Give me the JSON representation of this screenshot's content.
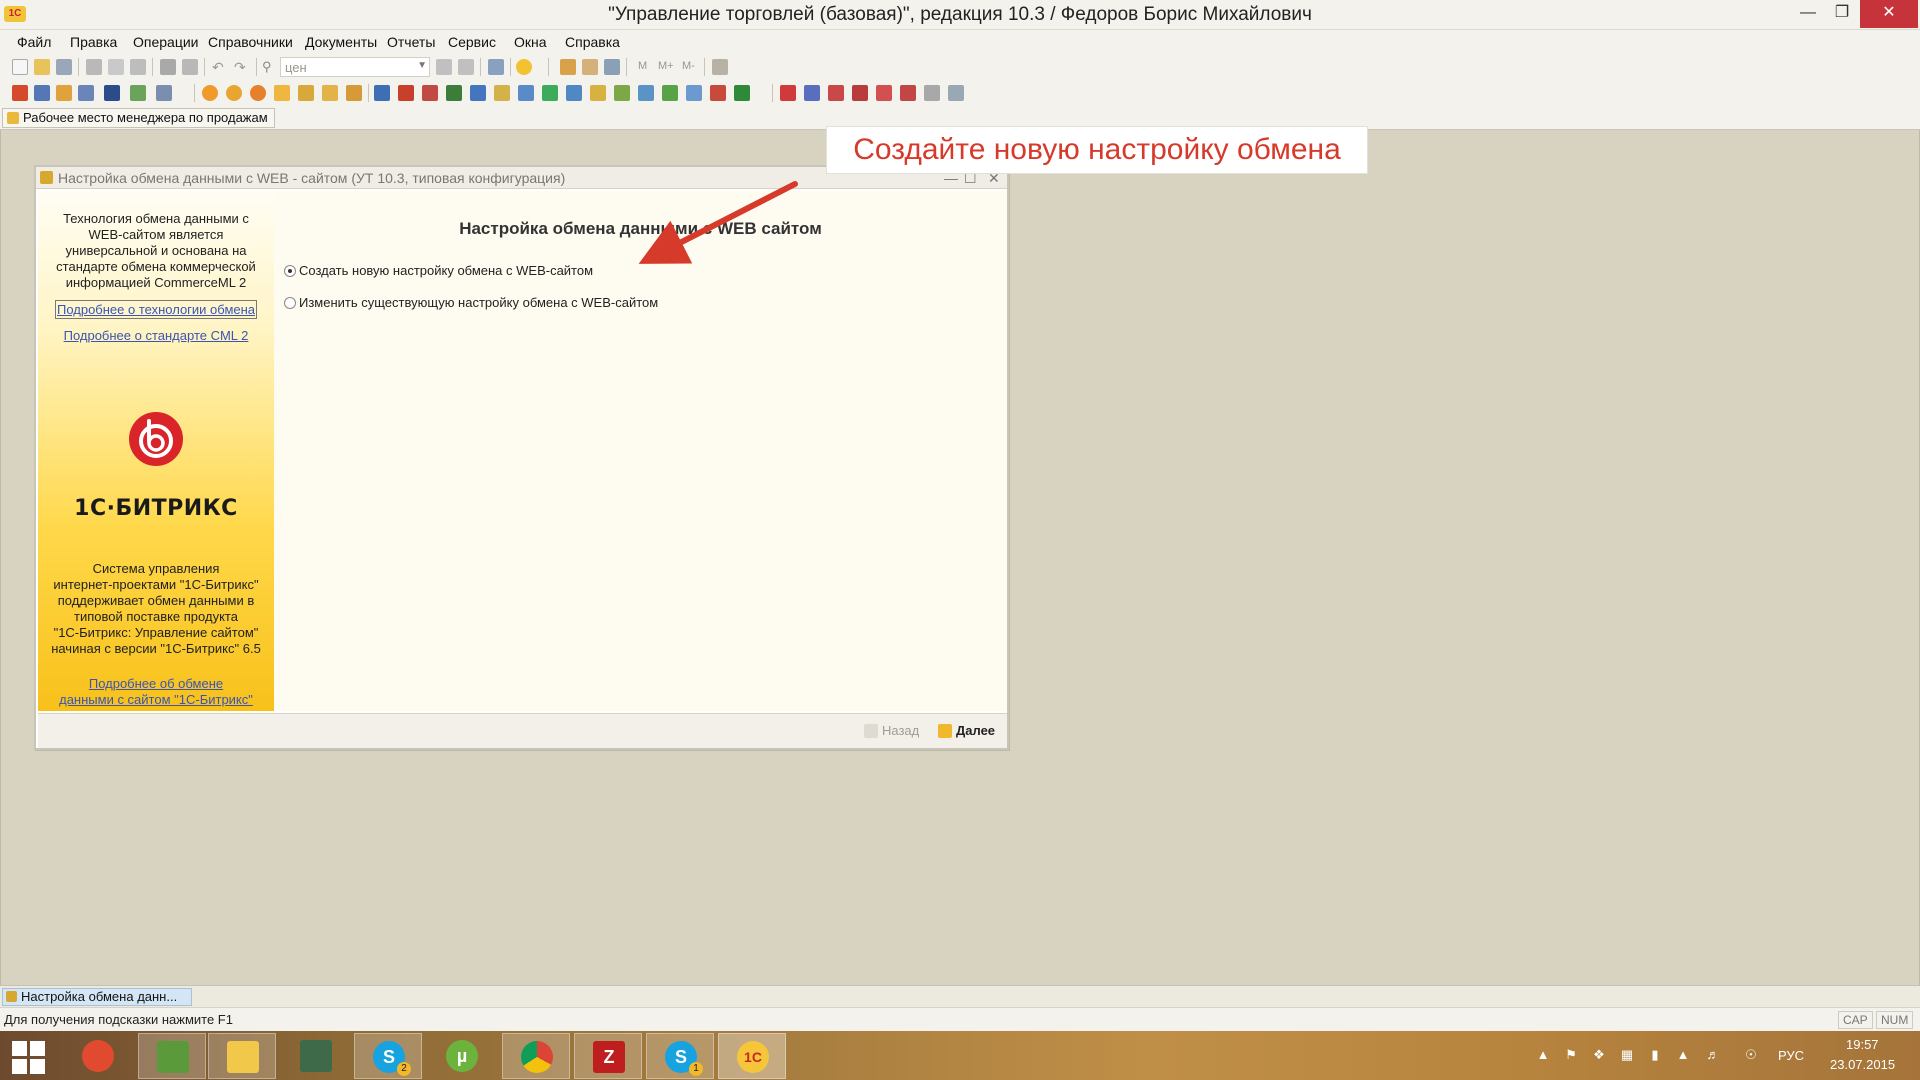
{
  "window": {
    "title": "\"Управление торговлей (базовая)\", редакция 10.3 / Федоров Борис Михайлович",
    "app_logo": "1С"
  },
  "menu": [
    "Файл",
    "Правка",
    "Операции",
    "Справочники",
    "Документы",
    "Отчеты",
    "Сервис",
    "Окна",
    "Справка"
  ],
  "toolbar": {
    "search_value": "цен",
    "memory_buttons": [
      "M",
      "M+",
      "M-"
    ]
  },
  "panel": {
    "workplace_label": "Рабочее место менеджера по продажам"
  },
  "callout": {
    "text": "Создайте новую настройку обмена",
    "color": "#d63a2a"
  },
  "dialog": {
    "title": "Настройка обмена данными с WEB - сайтом (УТ 10.3, типовая конфигурация)",
    "sidebar": {
      "intro_lines": [
        "Технология обмена данными с",
        "WEB-сайтом является",
        "универсальной и основана на",
        "стандарте обмена коммерческой",
        "информацией CommerceML 2"
      ],
      "link_technology": "Подробнее о технологии обмена",
      "link_cml": "Подробнее о стандарте CML 2",
      "logo_text": "1С·БИТРИКС",
      "description_lines": [
        "Система управления",
        "интернет-проектами \"1С-Битрикс\"",
        "поддерживает обмен данными в",
        "типовой поставке продукта",
        "\"1С-Битрикс: Управление сайтом\"",
        "начиная с версии \"1С-Битрикс\" 6.5"
      ],
      "link_exchange_lines": [
        "Подробнее об обмене",
        "данными с сайтом \"1С-Битрикс\""
      ]
    },
    "content": {
      "heading": "Настройка обмена данными с WEB сайтом",
      "options": [
        {
          "label": "Создать новую настройку обмена с WEB-сайтом",
          "checked": true
        },
        {
          "label": "Изменить существующую настройку обмена с WEB-сайтом",
          "checked": false
        }
      ]
    },
    "footer": {
      "back_label": "Назад",
      "next_label": "Далее"
    }
  },
  "windows_bar": {
    "open_window": "Настройка обмена данн..."
  },
  "status": {
    "hint": "Для получения подсказки нажмите F1",
    "caps": "CAP",
    "num": "NUM"
  },
  "taskbar": {
    "language": "РУС",
    "time": "19:57",
    "date": "23.07.2015",
    "skype_badge_1": "2",
    "skype_badge_2": "1"
  }
}
